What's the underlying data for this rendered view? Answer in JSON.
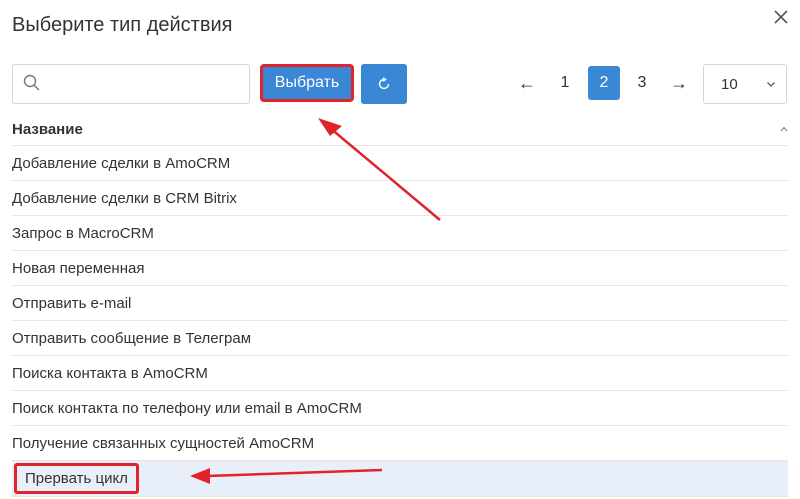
{
  "dialog": {
    "title": "Выберите тип действия",
    "close_icon": "close-icon"
  },
  "toolbar": {
    "search_placeholder": "",
    "search_value": "",
    "select_label": "Выбрать",
    "refresh_icon": "refresh-icon"
  },
  "pagination": {
    "prev": "←",
    "pages": [
      "1",
      "2",
      "3"
    ],
    "current_page": "2",
    "next": "→",
    "page_size": "10"
  },
  "table": {
    "column_header": "Название",
    "rows": [
      "Добавление сделки в AmoCRM",
      "Добавление сделки в CRM Bitrix",
      "Запрос в MacroCRM",
      "Новая переменная",
      "Отправить e-mail",
      "Отправить сообщение в Телеграм",
      "Поиска контакта в AmoCRM",
      "Поиск контакта по телефону или email в AmoCRM",
      "Получение связанных сущностей AmoCRM",
      "Прервать цикл"
    ],
    "selected_row": "Прервать цикл"
  },
  "colors": {
    "accent": "#3a87d6",
    "highlight": "#e0242c",
    "selected_row_bg": "#e9eff8"
  }
}
